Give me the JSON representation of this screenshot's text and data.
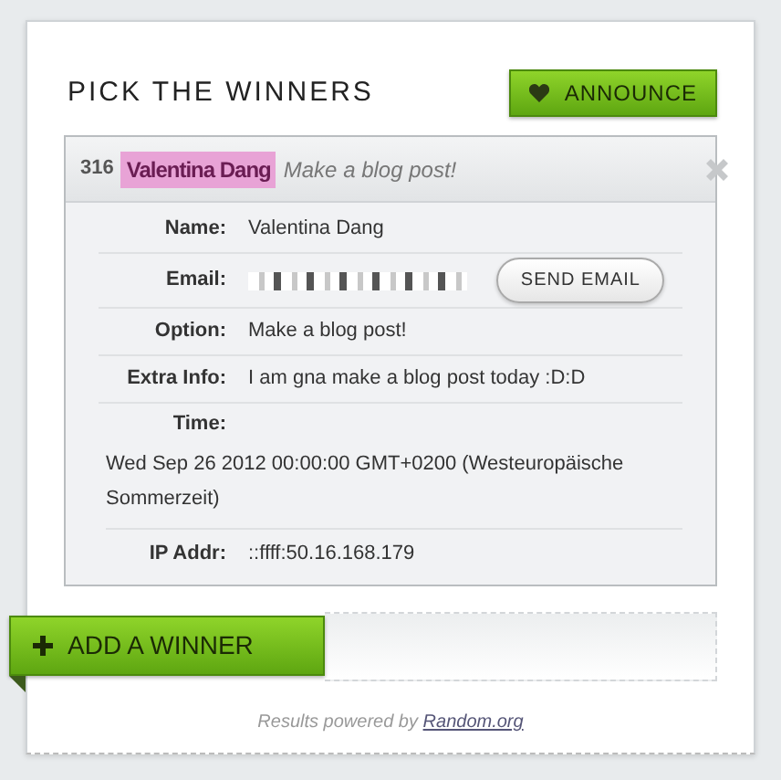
{
  "title": "PICK THE WINNERS",
  "announce_button": "ANNOUNCE",
  "entry": {
    "number": "316",
    "name": "Valentina Dang",
    "option": "Make a blog post!",
    "fields": [
      {
        "kind": "text",
        "label": "Name:",
        "value": "Valentina Dang"
      },
      {
        "kind": "email",
        "label": "Email:",
        "button": "SEND EMAIL"
      },
      {
        "kind": "text",
        "label": "Option:",
        "value": "Make a blog post!"
      },
      {
        "kind": "text",
        "label": "Extra Info:",
        "value": "I am gna make a blog post today :D:D"
      },
      {
        "kind": "block",
        "label": "Time:",
        "value": "Wed Sep 26 2012 00:00:00 GMT+0200 (Westeuropäische Sommerzeit)"
      },
      {
        "kind": "text",
        "label": "IP Addr:",
        "value": "::ffff:50.16.168.179"
      }
    ]
  },
  "add_button": "ADD A WINNER",
  "footer": {
    "text": "Results powered by",
    "link": "Random.org"
  }
}
